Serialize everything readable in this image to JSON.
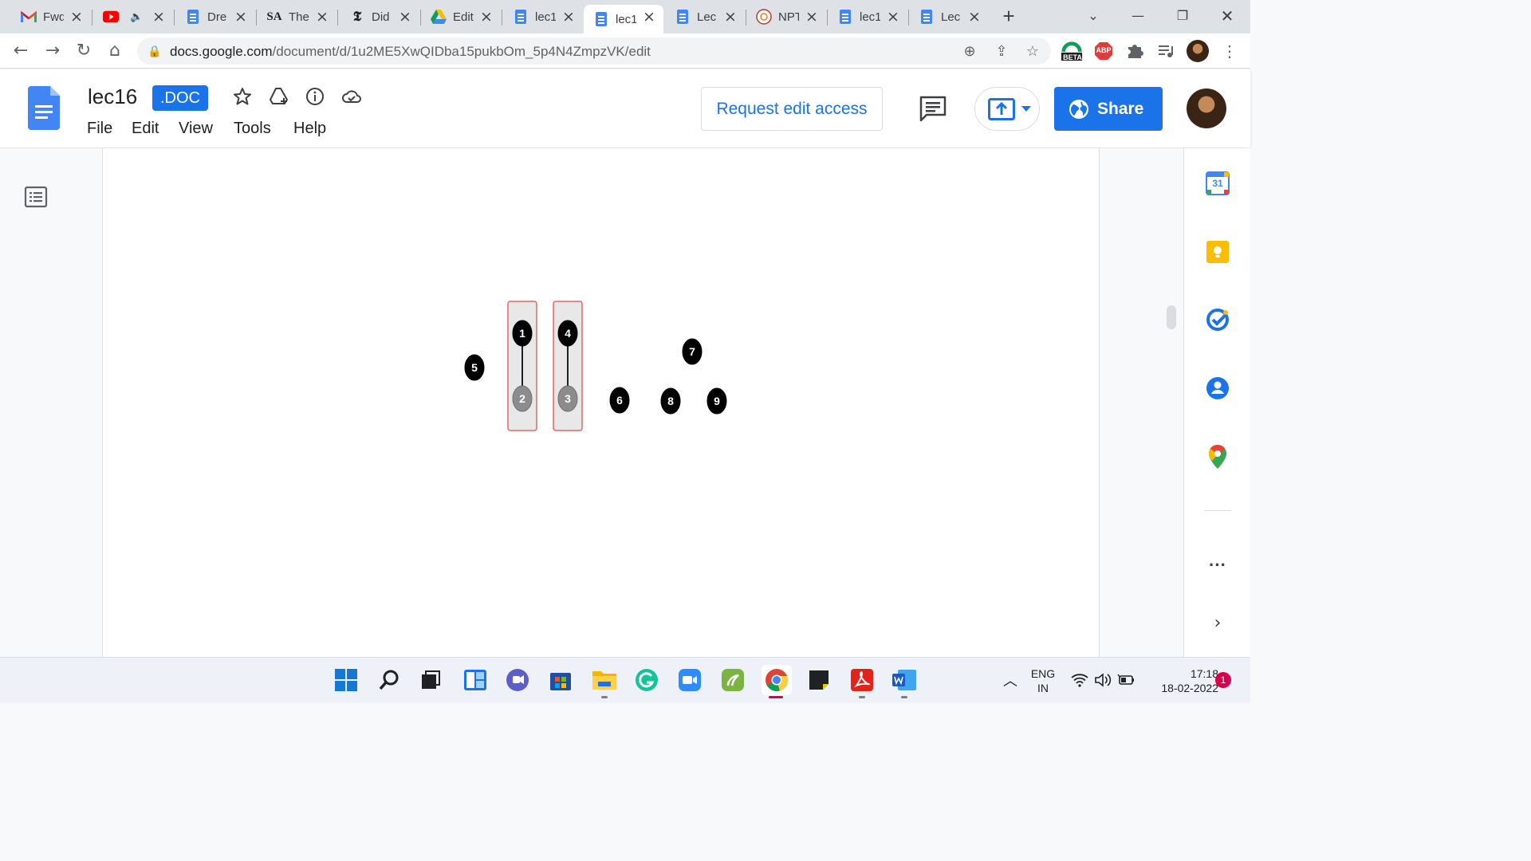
{
  "browser": {
    "tabs": [
      {
        "title": "Fwd",
        "icon": "gmail-icon"
      },
      {
        "title": "",
        "icon": "youtube-icon",
        "audio": true
      },
      {
        "title": "Dre",
        "icon": "docs-icon"
      },
      {
        "title": "The",
        "icon": "sa-icon"
      },
      {
        "title": "Did",
        "icon": "nyt-icon"
      },
      {
        "title": "Edit",
        "icon": "drive-icon"
      },
      {
        "title": "lec1",
        "icon": "docs-icon"
      },
      {
        "title": "lec1",
        "icon": "docs-icon",
        "active": true
      },
      {
        "title": "Lec",
        "icon": "docs-icon"
      },
      {
        "title": "NPT",
        "icon": "nptel-icon"
      },
      {
        "title": "lec1",
        "icon": "docs-icon"
      },
      {
        "title": "Lec",
        "icon": "docs-icon"
      }
    ],
    "url_host": "docs.google.com",
    "url_path": "/document/d/1u2ME5XwQIDba15pukbOm_5p4N4ZmpzVK/edit",
    "extension_badges": {
      "beta": "BETA",
      "abp": "ABP"
    }
  },
  "doc": {
    "title": "lec16",
    "badge": ".DOC",
    "menu": [
      "File",
      "Edit",
      "View",
      "Tools",
      "Help"
    ],
    "request_edit_label": "Request edit access",
    "share_label": "Share",
    "accent": "#1a73e8"
  },
  "figure": {
    "nodes": [
      {
        "label": "1",
        "style": "dark"
      },
      {
        "label": "2",
        "style": "grey"
      },
      {
        "label": "4",
        "style": "dark"
      },
      {
        "label": "3",
        "style": "grey"
      },
      {
        "label": "5",
        "style": "dark"
      },
      {
        "label": "6",
        "style": "dark"
      },
      {
        "label": "7",
        "style": "dark"
      },
      {
        "label": "8",
        "style": "dark"
      },
      {
        "label": "9",
        "style": "dark"
      }
    ],
    "edges": [
      [
        "1",
        "2"
      ],
      [
        "4",
        "3"
      ]
    ],
    "groups": [
      [
        "1",
        "2"
      ],
      [
        "4",
        "3"
      ]
    ],
    "group_border_color": "#e06666"
  },
  "side_panel": [
    "calendar-icon",
    "keep-icon",
    "tasks-icon",
    "contacts-icon",
    "maps-icon"
  ],
  "side_panel_calendar_day": "31",
  "taskbar": {
    "language_line1": "ENG",
    "language_line2": "IN",
    "time": "17:18",
    "date": "18-02-2022",
    "notifications": "1"
  }
}
